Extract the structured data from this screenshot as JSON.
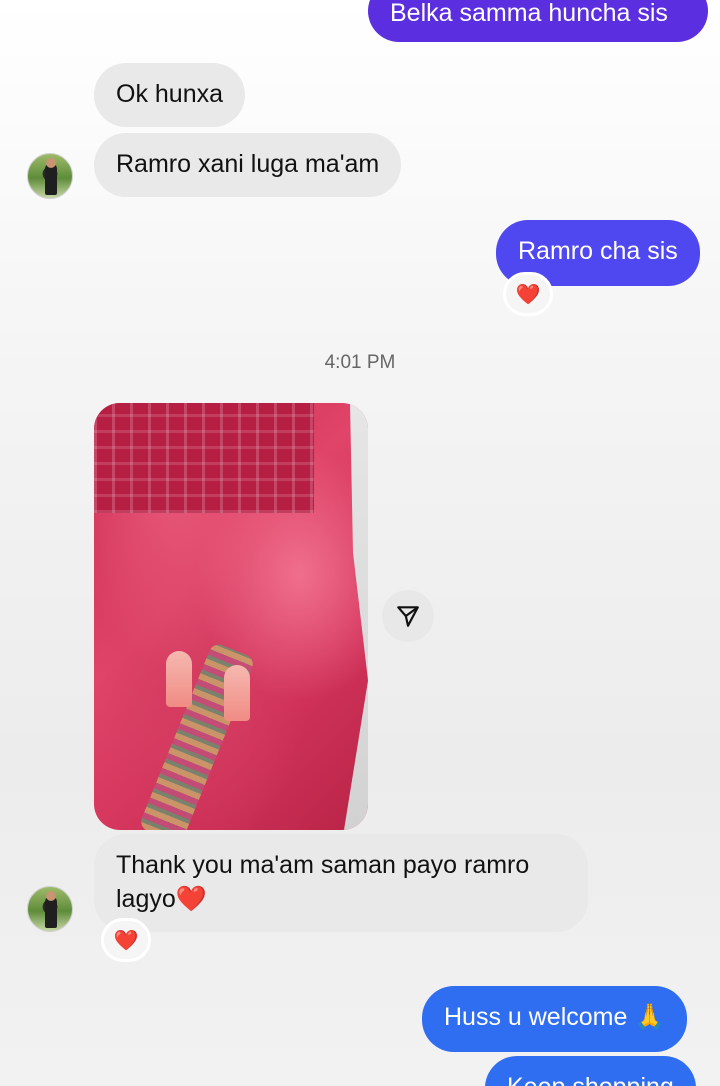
{
  "messages": {
    "m1": "Belka samma huncha sis",
    "m2": "Ok hunxa",
    "m3": "Ramro xani luga ma'am",
    "m4": "Ramro cha sis",
    "m4_reaction": "❤️",
    "timestamp": "4:01 PM",
    "m5_line1": "Thank you ma'am saman payo ramro",
    "m5_line2": "lagyo❤️",
    "m5_reaction": "❤️",
    "m6": "Huss u welcome 🙏",
    "m7": "Keep shopping"
  },
  "icons": {
    "share": "paper-plane-icon",
    "avatar": "contact-avatar"
  },
  "colors": {
    "incoming_bubble": "#e9e9e9",
    "outgoing_purple": "#5b2fe0",
    "outgoing_indigo": "#4f47f0",
    "outgoing_blue": "#2f6ef0",
    "reaction_heart": "#e0162b"
  }
}
